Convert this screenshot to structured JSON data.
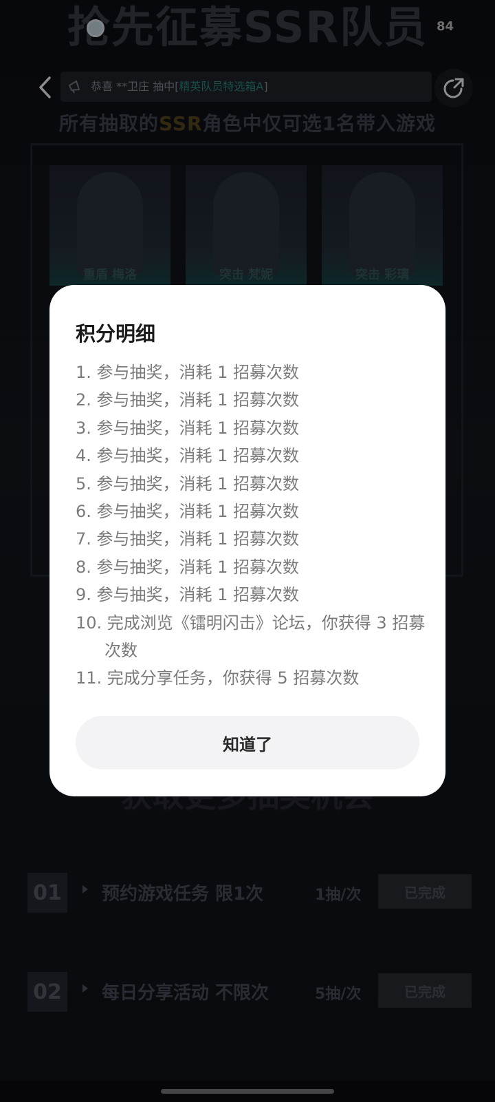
{
  "status_bar": {
    "battery": "84"
  },
  "header": {
    "hero_title": "抢先征募SSR队员",
    "ticker_text": "恭喜 **卫庄 抽中[",
    "ticker_prize": "精英队员特选箱A",
    "ticker_end": "]",
    "subtitle_pre": "所有抽取的",
    "subtitle_ssr": "SSR",
    "subtitle_post": "角色中仅可选1名带入游戏"
  },
  "characters": [
    {
      "name": "重盾 梅洛"
    },
    {
      "name": "突击 梵妮"
    },
    {
      "name": "突击 彩璃"
    }
  ],
  "section": {
    "title": "获取更多抽奖机会"
  },
  "tasks": [
    {
      "num": "01",
      "name": "预约游戏任务 限1次",
      "per": "1抽/次",
      "status": "已完成"
    },
    {
      "num": "02",
      "name": "每日分享活动 不限次",
      "per": "5抽/次",
      "status": "已完成"
    }
  ],
  "dialog": {
    "title": "积分明细",
    "items": [
      "1. 参与抽奖，消耗 1 招募次数",
      "2. 参与抽奖，消耗 1 招募次数",
      "3. 参与抽奖，消耗 1 招募次数",
      "4. 参与抽奖，消耗 1 招募次数",
      "5. 参与抽奖，消耗 1 招募次数",
      "6. 参与抽奖，消耗 1 招募次数",
      "7. 参与抽奖，消耗 1 招募次数",
      "8. 参与抽奖，消耗 1 招募次数",
      "9. 参与抽奖，消耗 1 招募次数",
      "10. 完成浏览《镭明闪击》论坛，你获得 3 招募次数",
      "11. 完成分享任务，你获得 5 招募次数"
    ],
    "button_label": "知道了"
  },
  "colors": {
    "background": "#101217",
    "dialog_bg": "#ffffff",
    "item_text": "#7b7b7b",
    "button_bg": "#f3f3f5"
  }
}
